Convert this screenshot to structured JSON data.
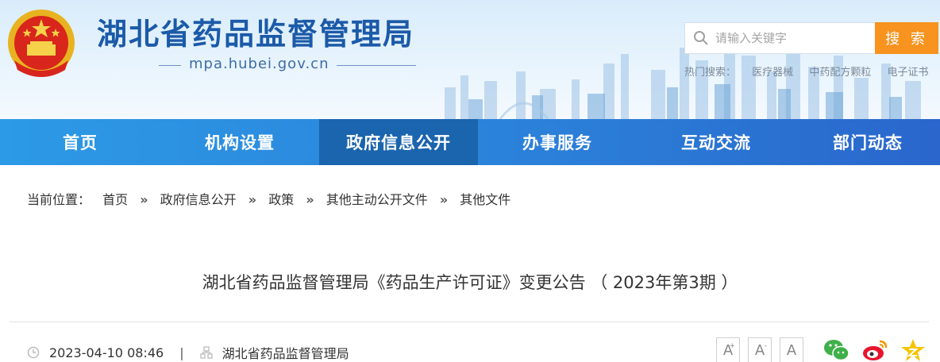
{
  "header": {
    "site_title": "湖北省药品监督管理局",
    "site_domain": "mpa.hubei.gov.cn",
    "search": {
      "placeholder": "请输入关键字",
      "button_label": "搜 索"
    },
    "hot_search": {
      "label": "热门搜索：",
      "items": [
        "医疗器械",
        "中药配方颗粒",
        "电子证书"
      ]
    }
  },
  "nav": {
    "items": [
      {
        "label": "首页"
      },
      {
        "label": "机构设置"
      },
      {
        "label": "政府信息公开",
        "active": true
      },
      {
        "label": "办事服务"
      },
      {
        "label": "互动交流"
      },
      {
        "label": "部门动态"
      }
    ]
  },
  "breadcrumb": {
    "label": "当前位置：",
    "items": [
      "首页",
      "政府信息公开",
      "政策",
      "其他主动公开文件",
      "其他文件"
    ],
    "separator": "»"
  },
  "article": {
    "title": "湖北省药品监督管理局《药品生产许可证》变更公告 （ 2023年第3期 ）",
    "date": "2023-04-10 08:46",
    "source": "湖北省药品监督管理局",
    "meta_separator": "|"
  },
  "tools": {
    "font_buttons": [
      "A",
      "A",
      "A"
    ],
    "share": [
      "wechat-icon",
      "weibo-icon",
      "qzone-icon"
    ]
  },
  "colors": {
    "brand_blue": "#1b5aa8",
    "nav_active": "#1b64ae",
    "search_button": "#f7931e"
  }
}
